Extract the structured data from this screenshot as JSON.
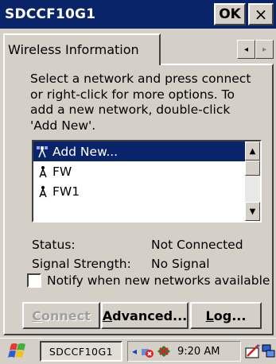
{
  "window": {
    "title": "SDCCF10G1",
    "ok_label": "OK",
    "close_label": "×"
  },
  "tabs": {
    "active_label": "Wireless Information",
    "scroll_left": "◂",
    "scroll_right": "▸"
  },
  "instructions": {
    "line1": "Select a network and press connect",
    "line2": "or right-click for more options.  To",
    "line3": "add a new network, double-click",
    "line4": "'Add New'."
  },
  "network_list": {
    "items": [
      {
        "label": "Add New...",
        "icon": "add-network-icon",
        "selected": true
      },
      {
        "label": "FW",
        "icon": "antenna-icon",
        "selected": false
      },
      {
        "label": "FW1",
        "icon": "antenna-icon",
        "selected": false
      }
    ],
    "scroll_up": "▲",
    "scroll_down": "▼"
  },
  "status": {
    "status_label": "Status:",
    "status_value": "Not Connected",
    "signal_label": "Signal Strength:",
    "signal_value": "No Signal"
  },
  "notify": {
    "label": "Notify when new networks available",
    "checked": false
  },
  "buttons": {
    "connect_first": "C",
    "connect_rest": "onnect",
    "advanced_first": "A",
    "advanced_rest": "dvanced...",
    "log_first": "L",
    "log_rest": "og..."
  },
  "taskbar": {
    "task_label": "SDCCF10G1",
    "time": "9:20 AM",
    "tray_arrow": "◂",
    "start_icon": "windows-flag-icon"
  },
  "colors": {
    "titlebar": "#0a246a",
    "face": "#d4d0c8",
    "selection": "#0a246a"
  }
}
